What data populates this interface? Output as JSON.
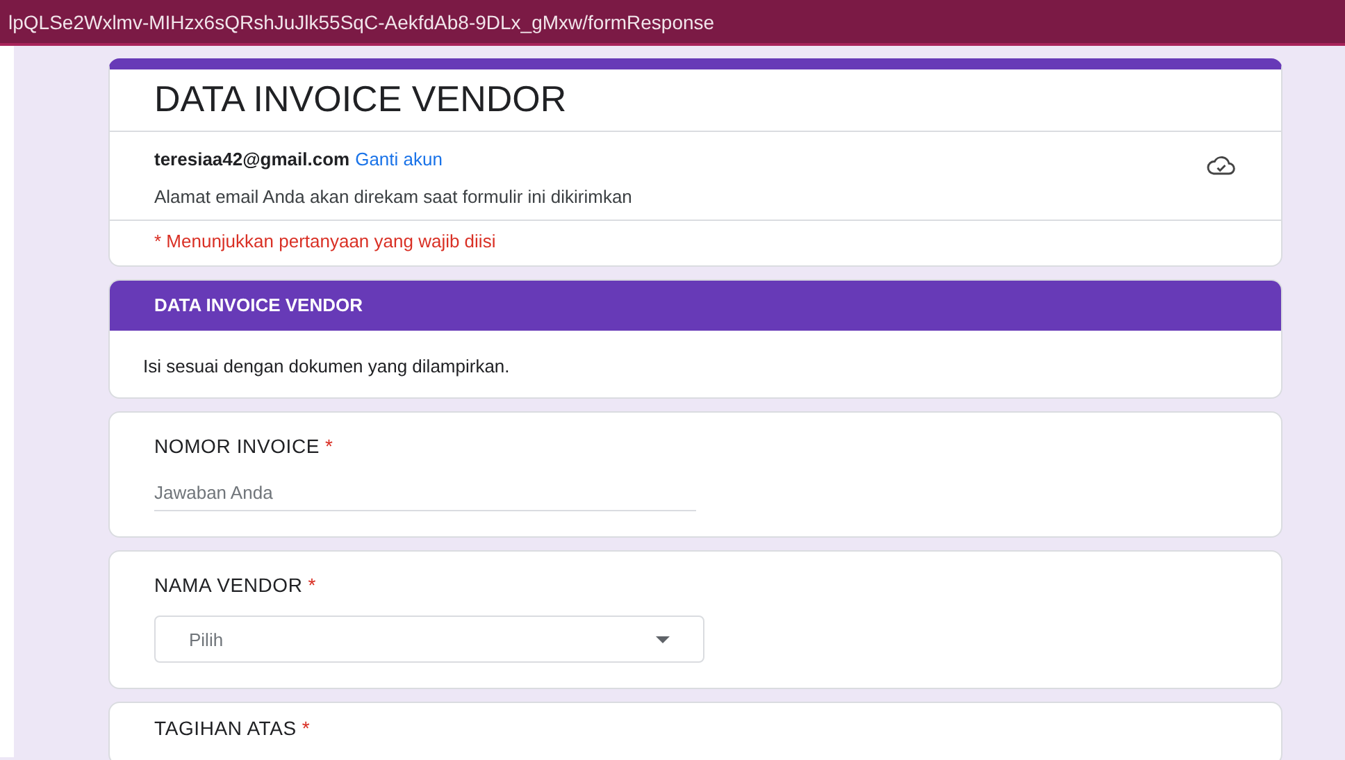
{
  "address_bar": {
    "url": "lpQLSe2Wxlmv-MIHzx6sQRshJuJlk55SqC-AekfdAb8-9DLx_gMxw/formResponse"
  },
  "form": {
    "title": "DATA INVOICE VENDOR",
    "email": "teresiaa42@gmail.com",
    "switch_account": "Ganti akun",
    "email_note": "Alamat email Anda akan direkam saat formulir ini dikirimkan",
    "required_note": "* Menunjukkan pertanyaan yang wajib diisi"
  },
  "section": {
    "title": "DATA INVOICE VENDOR",
    "description": "Isi sesuai dengan dokumen yang dilampirkan."
  },
  "questions": [
    {
      "kind": "text",
      "label": "NOMOR INVOICE",
      "required": true,
      "required_mark": "*",
      "placeholder": "Jawaban Anda"
    },
    {
      "kind": "dropdown",
      "label": "NAMA VENDOR",
      "required": true,
      "required_mark": "*",
      "value": "Pilih"
    },
    {
      "kind": "cut",
      "label": "TAGIHAN ATAS",
      "required": true,
      "required_mark": "*"
    }
  ]
}
